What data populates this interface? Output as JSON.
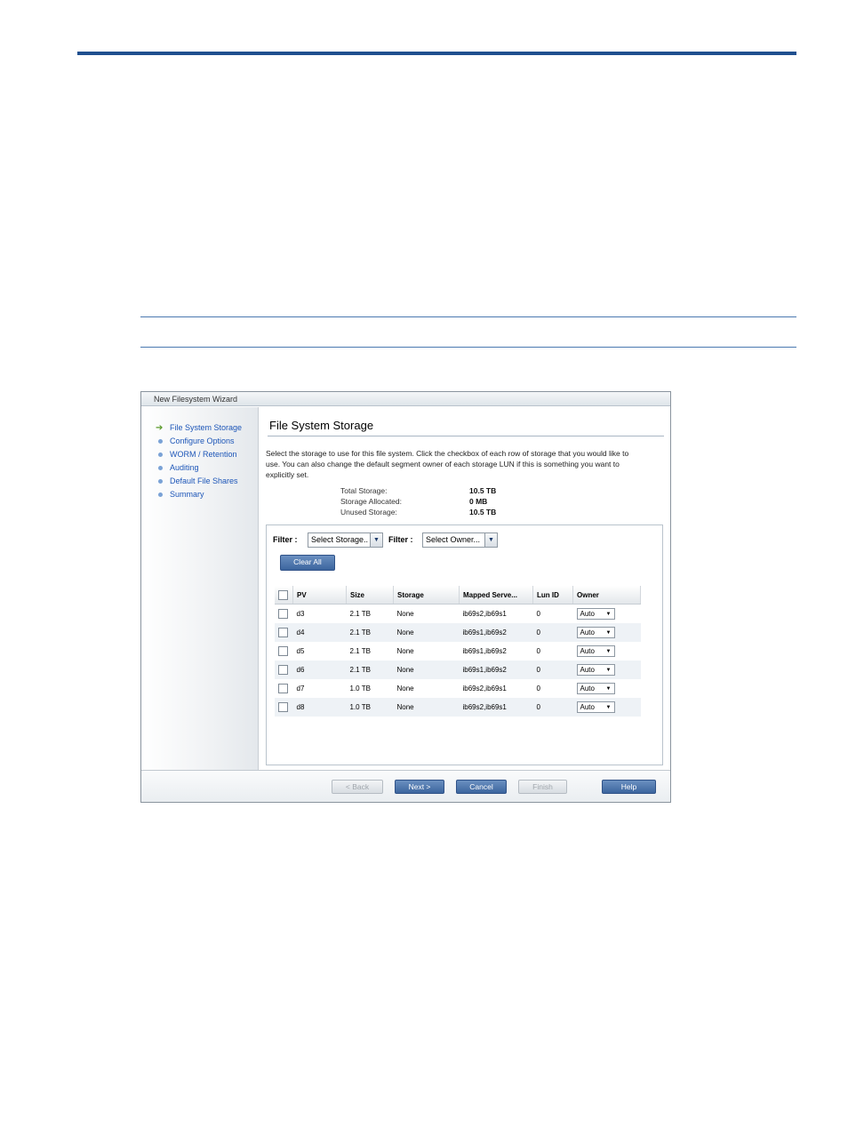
{
  "wizard": {
    "title": "New Filesystem Wizard",
    "steps": [
      {
        "label": "File System Storage",
        "current": true
      },
      {
        "label": "Configure Options"
      },
      {
        "label": "WORM / Retention"
      },
      {
        "label": "Auditing"
      },
      {
        "label": "Default File Shares"
      },
      {
        "label": "Summary"
      }
    ],
    "page_title": "File System Storage",
    "instructions": "Select the storage to use for this file system. Click the checkbox of each row of storage that you would like to use. You can also change the default segment owner of each storage LUN if this is something you want to explicitly set.",
    "summary": [
      {
        "label": "Total Storage:",
        "value": "10.5 TB"
      },
      {
        "label": "Storage Allocated:",
        "value": "0 MB"
      },
      {
        "label": "Unused Storage:",
        "value": "10.5 TB"
      }
    ],
    "filters": [
      {
        "label": "Filter :",
        "value": "Select Storage.."
      },
      {
        "label": "Filter :",
        "value": "Select Owner..."
      }
    ],
    "clear_all": "Clear All",
    "table": {
      "headers": [
        "PV",
        "Size",
        "Storage",
        "Mapped Serve...",
        "Lun ID",
        "Owner"
      ],
      "rows": [
        {
          "pv": "d3",
          "size": "2.1 TB",
          "storage": "None",
          "mapped": "ib69s2,ib69s1",
          "lun": "0",
          "owner": "Auto"
        },
        {
          "pv": "d4",
          "size": "2.1 TB",
          "storage": "None",
          "mapped": "ib69s1,ib69s2",
          "lun": "0",
          "owner": "Auto"
        },
        {
          "pv": "d5",
          "size": "2.1 TB",
          "storage": "None",
          "mapped": "ib69s1,ib69s2",
          "lun": "0",
          "owner": "Auto"
        },
        {
          "pv": "d6",
          "size": "2.1 TB",
          "storage": "None",
          "mapped": "ib69s1,ib69s2",
          "lun": "0",
          "owner": "Auto"
        },
        {
          "pv": "d7",
          "size": "1.0 TB",
          "storage": "None",
          "mapped": "ib69s2,ib69s1",
          "lun": "0",
          "owner": "Auto"
        },
        {
          "pv": "d8",
          "size": "1.0 TB",
          "storage": "None",
          "mapped": "ib69s2,ib69s1",
          "lun": "0",
          "owner": "Auto"
        }
      ]
    },
    "footer": {
      "back": "< Back",
      "next": "Next >",
      "cancel": "Cancel",
      "finish": "Finish",
      "help": "Help"
    }
  },
  "colors": {
    "accent_rule": "#1f4f8f",
    "link_blue": "#1d56b8",
    "button_blue": "#3c659e"
  }
}
